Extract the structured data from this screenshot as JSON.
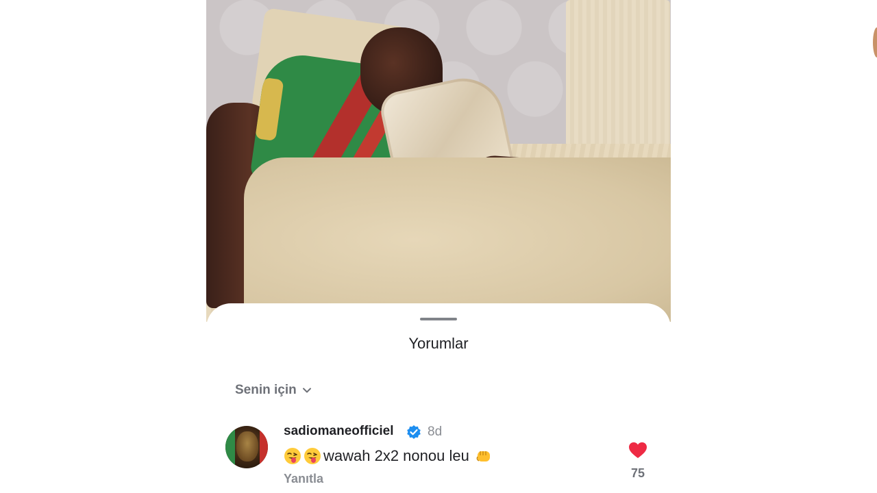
{
  "sheet": {
    "title": "Yorumlar",
    "filter_label": "Senin için"
  },
  "comment": {
    "username": "sadiomaneofficiel",
    "time": "8d",
    "text": "wawah 2x2 nonou leu",
    "emojis": [
      "stuck-out-tongue-winking-eye-emoji",
      "stuck-out-tongue-winking-eye-emoji",
      "oncoming-fist-emoji"
    ],
    "reply_label": "Yanıtla",
    "like_count": "75"
  },
  "colors": {
    "like_red": "#ee2a44",
    "verified_blue": "#1d8ef0"
  }
}
